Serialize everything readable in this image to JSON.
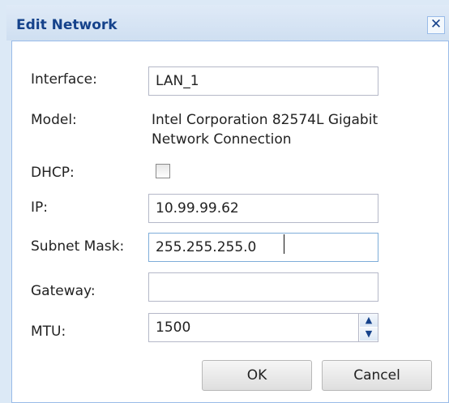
{
  "dialog": {
    "title": "Edit Network",
    "close_glyph": "✕"
  },
  "fields": {
    "interface": {
      "label": "Interface:",
      "value": "LAN_1"
    },
    "model": {
      "label": "Model:",
      "value_line1": "Intel Corporation 82574L Gigabit",
      "value_line2": "Network Connection"
    },
    "dhcp": {
      "label": "DHCP:",
      "checked": false
    },
    "ip": {
      "label": "IP:",
      "value": "10.99.99.62"
    },
    "subnet_mask": {
      "label": "Subnet Mask:",
      "value": "255.255.255.0"
    },
    "gateway": {
      "label": "Gateway:",
      "value": ""
    },
    "mtu": {
      "label": "MTU:",
      "value": "1500"
    }
  },
  "icons": {
    "close": "close-icon",
    "spin_up": "chevron-up-icon",
    "spin_down": "chevron-down-icon",
    "spin_up_glyph": "▲",
    "spin_down_glyph": "▼"
  },
  "buttons": {
    "ok": "OK",
    "cancel": "Cancel"
  },
  "colors": {
    "title_text": "#15428b",
    "panel_border": "#99bbe8",
    "dialog_bg": "#dce9f6"
  }
}
